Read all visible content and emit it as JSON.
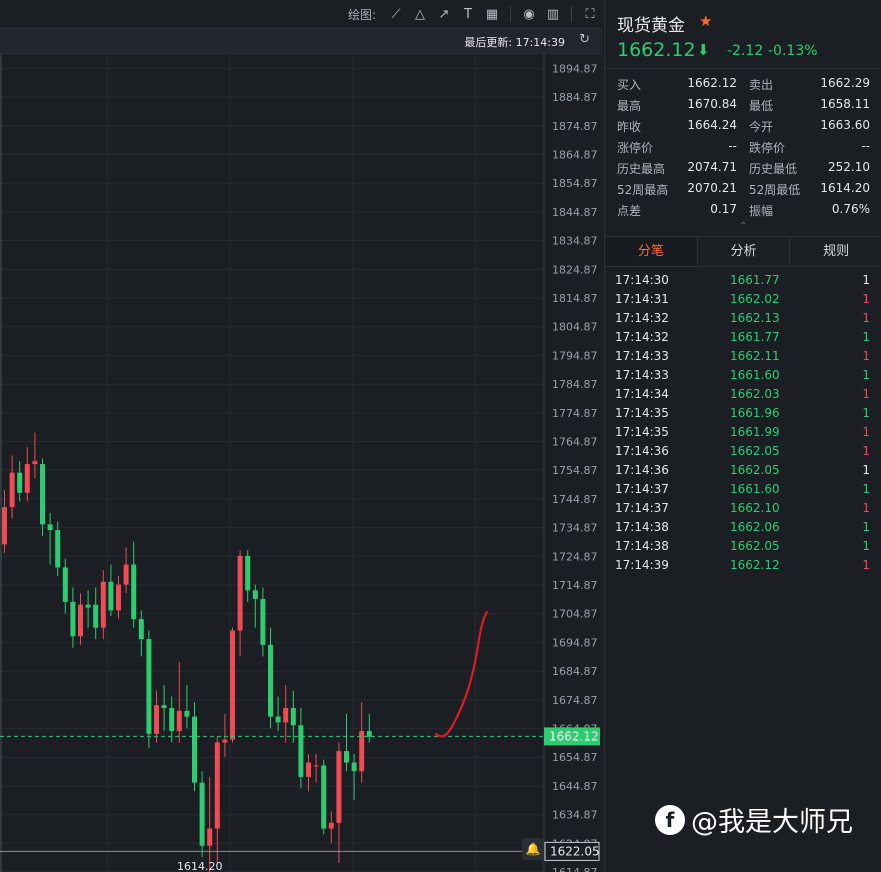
{
  "toolbar": {
    "draw_label": "绘图:",
    "icons": [
      "line-tool-icon",
      "triangle-tool-icon",
      "arrow-tool-icon",
      "text-tool-icon",
      "grid-tool-icon",
      "eye-icon",
      "trash-icon",
      "fullscreen-icon"
    ]
  },
  "update": {
    "label": "最后更新:",
    "time": "17:14:39"
  },
  "instrument": {
    "name": "现货黄金",
    "price": "1662.12",
    "change": "-2.12",
    "change_pct": "-0.13%"
  },
  "stats": [
    {
      "k1": "买入",
      "v1": "1662.12",
      "k2": "卖出",
      "v2": "1662.29"
    },
    {
      "k1": "最高",
      "v1": "1670.84",
      "k2": "最低",
      "v2": "1658.11"
    },
    {
      "k1": "昨收",
      "v1": "1664.24",
      "k2": "今开",
      "v2": "1663.60"
    },
    {
      "k1": "涨停价",
      "v1": "--",
      "k2": "跌停价",
      "v2": "--"
    },
    {
      "k1": "历史最高",
      "v1": "2074.71",
      "k2": "历史最低",
      "v2": "252.10"
    },
    {
      "k1": "52周最高",
      "v1": "2070.21",
      "k2": "52周最低",
      "v2": "1614.20"
    },
    {
      "k1": "点差",
      "v1": "0.17",
      "k2": "振幅",
      "v2": "0.76%"
    }
  ],
  "tabs": [
    "分笔",
    "分析",
    "规则"
  ],
  "trades": [
    {
      "time": "17:14:30",
      "price": "1661.77",
      "vol": "1",
      "dir": "neutral"
    },
    {
      "time": "17:14:31",
      "price": "1662.02",
      "vol": "1",
      "dir": "up"
    },
    {
      "time": "17:14:32",
      "price": "1662.13",
      "vol": "1",
      "dir": "up"
    },
    {
      "time": "17:14:32",
      "price": "1661.77",
      "vol": "1",
      "dir": "down"
    },
    {
      "time": "17:14:33",
      "price": "1662.11",
      "vol": "1",
      "dir": "up"
    },
    {
      "time": "17:14:33",
      "price": "1661.60",
      "vol": "1",
      "dir": "down"
    },
    {
      "time": "17:14:34",
      "price": "1662.03",
      "vol": "1",
      "dir": "up"
    },
    {
      "time": "17:14:35",
      "price": "1661.96",
      "vol": "1",
      "dir": "down"
    },
    {
      "time": "17:14:35",
      "price": "1661.99",
      "vol": "1",
      "dir": "up"
    },
    {
      "time": "17:14:36",
      "price": "1662.05",
      "vol": "1",
      "dir": "up"
    },
    {
      "time": "17:14:36",
      "price": "1662.05",
      "vol": "1",
      "dir": "neutral"
    },
    {
      "time": "17:14:37",
      "price": "1661.60",
      "vol": "1",
      "dir": "down"
    },
    {
      "time": "17:14:37",
      "price": "1662.10",
      "vol": "1",
      "dir": "up"
    },
    {
      "time": "17:14:38",
      "price": "1662.06",
      "vol": "1",
      "dir": "down"
    },
    {
      "time": "17:14:38",
      "price": "1662.05",
      "vol": "1",
      "dir": "down"
    },
    {
      "time": "17:14:39",
      "price": "1662.12",
      "vol": "1",
      "dir": "up"
    }
  ],
  "colors": {
    "up": "#f04b55",
    "down": "#2ecc71",
    "neutral": "#e3e6ea",
    "accent": "#ff6a2c"
  },
  "watermark": "@我是大师兄",
  "chart_data": {
    "type": "candlestick",
    "ylim": [
      1614.87,
      1899.87
    ],
    "yticks": [
      "1894.87",
      "1884.87",
      "1874.87",
      "1864.87",
      "1854.87",
      "1844.87",
      "1834.87",
      "1824.87",
      "1814.87",
      "1804.87",
      "1794.87",
      "1784.87",
      "1774.87",
      "1764.87",
      "1754.87",
      "1744.87",
      "1734.87",
      "1724.87",
      "1714.87",
      "1704.87",
      "1694.87",
      "1684.87",
      "1674.87",
      "1664.87",
      "1654.87",
      "1644.87",
      "1634.87",
      "1624.87",
      "1614.87"
    ],
    "current_price": "1662.12",
    "current_price_value": 1662.12,
    "alert_price": "1622.05",
    "alert_price_value": 1622.05,
    "low_label": "1614.20",
    "low_label_value": 1614.2,
    "candles": [
      {
        "o": 1729,
        "h": 1748,
        "l": 1726,
        "c": 1742
      },
      {
        "o": 1742,
        "h": 1760,
        "l": 1738,
        "c": 1754
      },
      {
        "o": 1754,
        "h": 1758,
        "l": 1744,
        "c": 1747
      },
      {
        "o": 1747,
        "h": 1763,
        "l": 1744,
        "c": 1757
      },
      {
        "o": 1757,
        "h": 1768,
        "l": 1752,
        "c": 1758
      },
      {
        "o": 1757,
        "h": 1759,
        "l": 1732,
        "c": 1736
      },
      {
        "o": 1736,
        "h": 1740,
        "l": 1722,
        "c": 1734
      },
      {
        "o": 1734,
        "h": 1737,
        "l": 1718,
        "c": 1721
      },
      {
        "o": 1721,
        "h": 1724,
        "l": 1705,
        "c": 1709
      },
      {
        "o": 1709,
        "h": 1714,
        "l": 1693,
        "c": 1697
      },
      {
        "o": 1697,
        "h": 1712,
        "l": 1694,
        "c": 1708
      },
      {
        "o": 1708,
        "h": 1713,
        "l": 1700,
        "c": 1707
      },
      {
        "o": 1708,
        "h": 1714,
        "l": 1696,
        "c": 1700
      },
      {
        "o": 1700,
        "h": 1720,
        "l": 1696,
        "c": 1716
      },
      {
        "o": 1716,
        "h": 1722,
        "l": 1704,
        "c": 1706
      },
      {
        "o": 1706,
        "h": 1718,
        "l": 1703,
        "c": 1715
      },
      {
        "o": 1715,
        "h": 1728,
        "l": 1712,
        "c": 1722
      },
      {
        "o": 1722,
        "h": 1730,
        "l": 1700,
        "c": 1703
      },
      {
        "o": 1703,
        "h": 1706,
        "l": 1690,
        "c": 1696
      },
      {
        "o": 1696,
        "h": 1699,
        "l": 1658,
        "c": 1663
      },
      {
        "o": 1663,
        "h": 1678,
        "l": 1660,
        "c": 1673
      },
      {
        "o": 1673,
        "h": 1680,
        "l": 1664,
        "c": 1672
      },
      {
        "o": 1672,
        "h": 1676,
        "l": 1660,
        "c": 1664
      },
      {
        "o": 1664,
        "h": 1688,
        "l": 1660,
        "c": 1671
      },
      {
        "o": 1671,
        "h": 1680,
        "l": 1665,
        "c": 1669
      },
      {
        "o": 1669,
        "h": 1674,
        "l": 1643,
        "c": 1646
      },
      {
        "o": 1646,
        "h": 1650,
        "l": 1620,
        "c": 1624
      },
      {
        "o": 1624,
        "h": 1648,
        "l": 1614.2,
        "c": 1630
      },
      {
        "o": 1630,
        "h": 1662,
        "l": 1618,
        "c": 1660
      },
      {
        "o": 1660,
        "h": 1670,
        "l": 1655,
        "c": 1661
      },
      {
        "o": 1661,
        "h": 1700,
        "l": 1660,
        "c": 1699
      },
      {
        "o": 1699,
        "h": 1727,
        "l": 1690,
        "c": 1725
      },
      {
        "o": 1725,
        "h": 1727,
        "l": 1709,
        "c": 1713
      },
      {
        "o": 1713,
        "h": 1715,
        "l": 1700,
        "c": 1710
      },
      {
        "o": 1710,
        "h": 1714,
        "l": 1690,
        "c": 1694
      },
      {
        "o": 1694,
        "h": 1700,
        "l": 1665,
        "c": 1669
      },
      {
        "o": 1669,
        "h": 1676,
        "l": 1664,
        "c": 1667
      },
      {
        "o": 1667,
        "h": 1680,
        "l": 1660,
        "c": 1672
      },
      {
        "o": 1672,
        "h": 1678,
        "l": 1660,
        "c": 1666
      },
      {
        "o": 1666,
        "h": 1672,
        "l": 1644,
        "c": 1648
      },
      {
        "o": 1648,
        "h": 1656,
        "l": 1643,
        "c": 1653
      },
      {
        "o": 1652,
        "h": 1656,
        "l": 1646,
        "c": 1652
      },
      {
        "o": 1652,
        "h": 1654,
        "l": 1628,
        "c": 1630
      },
      {
        "o": 1630,
        "h": 1636,
        "l": 1625,
        "c": 1632
      },
      {
        "o": 1632,
        "h": 1660,
        "l": 1618,
        "c": 1657
      },
      {
        "o": 1657,
        "h": 1670,
        "l": 1650,
        "c": 1653
      },
      {
        "o": 1653,
        "h": 1656,
        "l": 1640,
        "c": 1650
      },
      {
        "o": 1650,
        "h": 1674,
        "l": 1646,
        "c": 1664
      },
      {
        "o": 1664,
        "h": 1670,
        "l": 1660,
        "c": 1662
      }
    ]
  }
}
